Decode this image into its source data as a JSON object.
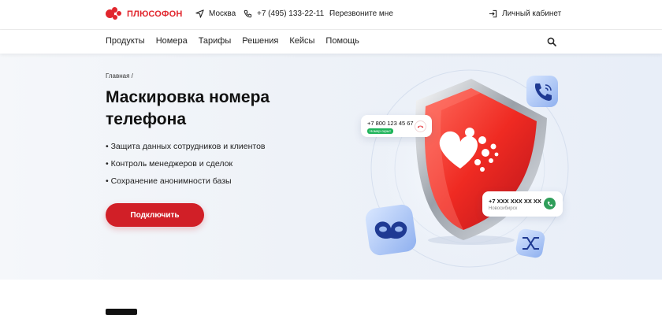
{
  "header": {
    "brand": "ПЛЮСОФОН",
    "city": "Москва",
    "phone": "+7 (495) 133-22-11",
    "callback": "Перезвоните мне",
    "account": "Личный кабинет"
  },
  "nav": {
    "items": [
      "Продукты",
      "Номера",
      "Тарифы",
      "Решения",
      "Кейсы",
      "Помощь"
    ]
  },
  "hero": {
    "breadcrumb": "Главная /",
    "title": "Маскировка номера телефона",
    "bullets": [
      "• Защита данных сотрудников и клиентов",
      "• Контроль менеджеров и сделок",
      "• Сохранение анонимности базы"
    ],
    "cta": "Подключить"
  },
  "cards": {
    "incoming_number": "+7 800 123 45 67",
    "incoming_tag": "Номер скрыт",
    "outgoing_number": "+7 XXX XXX XX XX",
    "outgoing_city": "Новосибирск"
  },
  "colors": {
    "brand": "#e1262d",
    "cta": "#d11f27",
    "call_green": "#2f9e5a",
    "tag_green": "#1fb45a"
  }
}
